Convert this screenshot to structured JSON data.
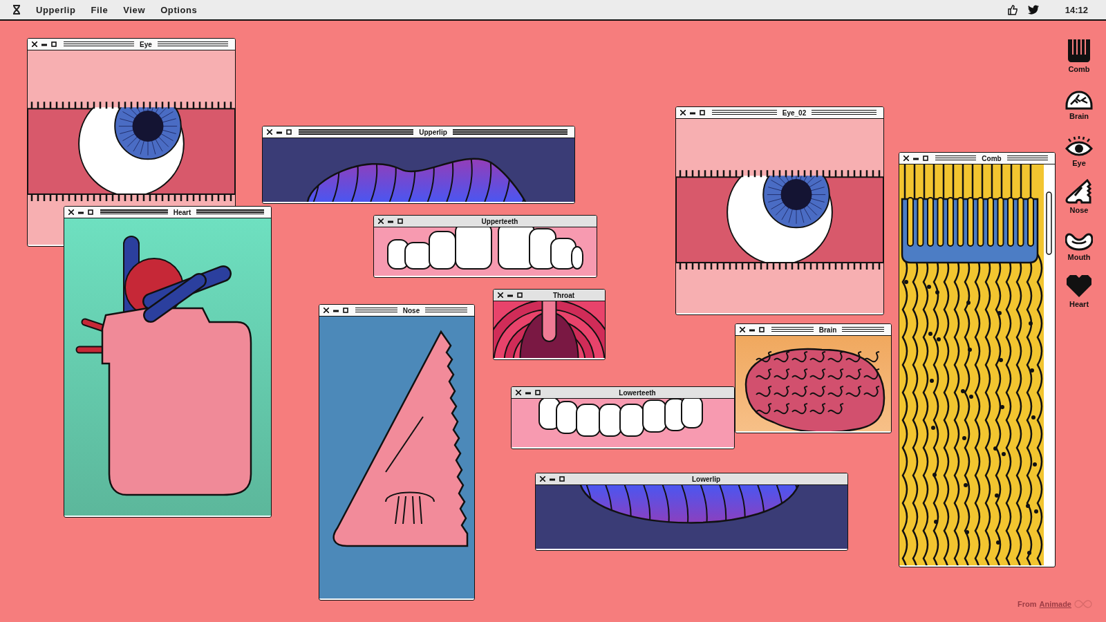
{
  "menu_bar": {
    "app_menu": "Upperlip",
    "menus": [
      "File",
      "View",
      "Options"
    ],
    "clock": "14:12"
  },
  "windows": [
    {
      "title": "Eye",
      "kind": "eye",
      "active": true
    },
    {
      "title": "Heart",
      "kind": "heart",
      "active": true
    },
    {
      "title": "Upperlip",
      "kind": "upperlip",
      "active": true
    },
    {
      "title": "Upperteeth",
      "kind": "upperteeth",
      "active": false
    },
    {
      "title": "Throat",
      "kind": "throat",
      "active": false
    },
    {
      "title": "Nose",
      "kind": "nose",
      "active": true
    },
    {
      "title": "Lowerteeth",
      "kind": "lowerteeth",
      "active": false
    },
    {
      "title": "Lowerlip",
      "kind": "lowerlip",
      "active": false
    },
    {
      "title": "Eye_02",
      "kind": "eye",
      "active": true
    },
    {
      "title": "Brain",
      "kind": "brain",
      "active": true
    },
    {
      "title": "Comb",
      "kind": "comb",
      "active": true
    }
  ],
  "dock": [
    {
      "label": "Comb",
      "kind": "comb"
    },
    {
      "label": "Brain",
      "kind": "brain"
    },
    {
      "label": "Eye",
      "kind": "eye"
    },
    {
      "label": "Nose",
      "kind": "nose"
    },
    {
      "label": "Mouth",
      "kind": "mouth"
    },
    {
      "label": "Heart",
      "kind": "heart"
    }
  ],
  "credit": {
    "prefix": "From",
    "link": "Animade"
  }
}
